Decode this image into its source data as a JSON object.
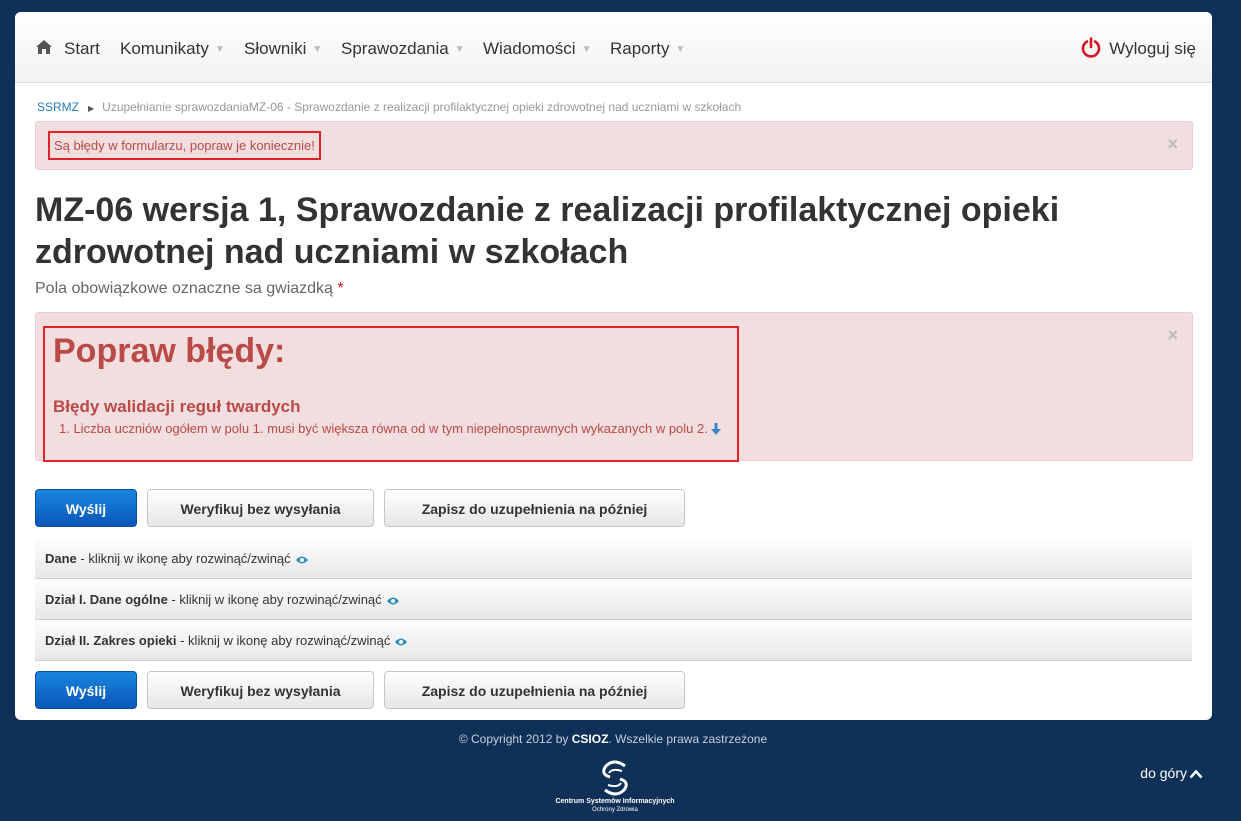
{
  "nav": {
    "home_label": "Start",
    "items": [
      {
        "label": "Komunikaty"
      },
      {
        "label": "Słowniki"
      },
      {
        "label": "Sprawozdania"
      },
      {
        "label": "Wiadomości"
      },
      {
        "label": "Raporty"
      }
    ],
    "logout_label": "Wyloguj się"
  },
  "breadcrumb": {
    "root": "SSRMZ",
    "current": "Uzupełnianie sprawozdaniaMZ-06 - Sprawozdanie z realizacji profilaktycznej opieki zdrowotnej nad uczniami w szkołach"
  },
  "alert_top": {
    "message": "Są błędy w formularzu, popraw je koniecznie!",
    "close": "×"
  },
  "page": {
    "title": "MZ-06 wersja 1, Sprawozdanie z realizacji profilaktycznej opieki zdrowotnej nad uczniami w szkołach",
    "subtitle": "Pola obowiązkowe oznaczne sa gwiazdką",
    "required_mark": "*"
  },
  "errors": {
    "heading": "Popraw błędy:",
    "subheading": "Błędy walidacji reguł twardych",
    "items": [
      "1.  Liczba uczniów ogółem w polu 1. musi być większa równa od w tym niepełnosprawnych wykazanych w polu 2."
    ],
    "close": "×"
  },
  "buttons": {
    "send": "Wyślij",
    "verify": "Weryfikuj bez wysyłania",
    "save": "Zapisz do uzupełnienia na później"
  },
  "sections": [
    {
      "title": "Dane",
      "hint": " - kliknij w ikonę aby rozwinąć/zwinąć"
    },
    {
      "title": "Dział I. Dane ogólne",
      "hint": " - kliknij w ikonę aby rozwinąć/zwinąć"
    },
    {
      "title": "Dział II. Zakres opieki",
      "hint": " - kliknij w ikonę aby rozwinąć/zwinąć"
    }
  ],
  "footer": {
    "copyright_prefix": "© Copyright 2012 by ",
    "org": "CSIOZ",
    "copyright_suffix": ". Wszelkie prawa zastrzeżone",
    "logo_line1": "Centrum Systemów Informacyjnych",
    "logo_line2": "Ochrony Zdrowia",
    "to_top": "do góry"
  },
  "colors": {
    "page_bg": "#0f3057",
    "alert_bg": "#f2dede",
    "alert_text": "#b94a48",
    "primary": "#0d6fcf",
    "highlight_border": "#e0202a"
  },
  "icons": [
    "home-icon",
    "power-icon",
    "arrow-down-icon",
    "eye-icon",
    "chevron-up-icon"
  ]
}
